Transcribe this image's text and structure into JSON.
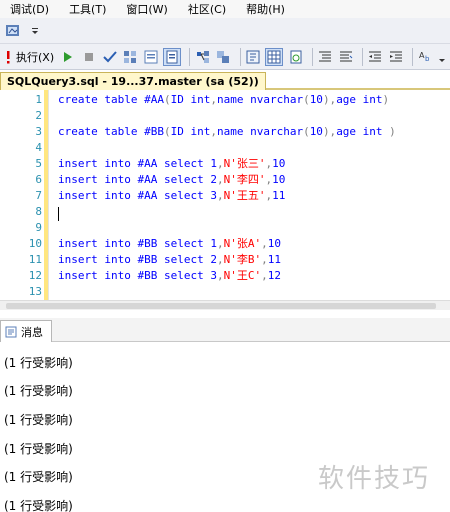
{
  "menubar": {
    "items": [
      "调试(D)",
      "工具(T)",
      "窗口(W)",
      "社区(C)",
      "帮助(H)"
    ]
  },
  "toolbar": {
    "execute_label": "执行(X)"
  },
  "tab": {
    "title": "SQLQuery3.sql - 19...37.master (sa (52))"
  },
  "editor": {
    "lines": [
      {
        "n": "1",
        "tokens": [
          {
            "t": "create table #AA",
            "c": ""
          },
          {
            "t": "(",
            "c": "gray"
          },
          {
            "t": "ID int",
            "c": ""
          },
          {
            "t": ",",
            "c": "gray"
          },
          {
            "t": "name nvarchar",
            "c": ""
          },
          {
            "t": "(",
            "c": "gray"
          },
          {
            "t": "10",
            "c": ""
          },
          {
            "t": "),",
            "c": "gray"
          },
          {
            "t": "age int",
            "c": ""
          },
          {
            "t": ")",
            "c": "gray"
          }
        ]
      },
      {
        "n": "2",
        "tokens": []
      },
      {
        "n": "3",
        "tokens": [
          {
            "t": "create table #BB",
            "c": ""
          },
          {
            "t": "(",
            "c": "gray"
          },
          {
            "t": "ID int",
            "c": ""
          },
          {
            "t": ",",
            "c": "gray"
          },
          {
            "t": "name nvarchar",
            "c": ""
          },
          {
            "t": "(",
            "c": "gray"
          },
          {
            "t": "10",
            "c": ""
          },
          {
            "t": "),",
            "c": "gray"
          },
          {
            "t": "age int ",
            "c": ""
          },
          {
            "t": ")",
            "c": "gray"
          }
        ]
      },
      {
        "n": "4",
        "tokens": []
      },
      {
        "n": "5",
        "tokens": [
          {
            "t": "insert into #AA select 1",
            "c": ""
          },
          {
            "t": ",",
            "c": "gray"
          },
          {
            "t": "N'张三'",
            "c": "red"
          },
          {
            "t": ",",
            "c": "gray"
          },
          {
            "t": "10",
            "c": ""
          }
        ]
      },
      {
        "n": "6",
        "tokens": [
          {
            "t": "insert into #AA select 2",
            "c": ""
          },
          {
            "t": ",",
            "c": "gray"
          },
          {
            "t": "N'李四'",
            "c": "red"
          },
          {
            "t": ",",
            "c": "gray"
          },
          {
            "t": "10",
            "c": ""
          }
        ]
      },
      {
        "n": "7",
        "tokens": [
          {
            "t": "insert into #AA select 3",
            "c": ""
          },
          {
            "t": ",",
            "c": "gray"
          },
          {
            "t": "N'王五'",
            "c": "red"
          },
          {
            "t": ",",
            "c": "gray"
          },
          {
            "t": "11",
            "c": ""
          }
        ]
      },
      {
        "n": "8",
        "tokens": []
      },
      {
        "n": "9",
        "tokens": []
      },
      {
        "n": "10",
        "tokens": [
          {
            "t": "insert into #BB select 1",
            "c": ""
          },
          {
            "t": ",",
            "c": "gray"
          },
          {
            "t": "N'张A'",
            "c": "red"
          },
          {
            "t": ",",
            "c": "gray"
          },
          {
            "t": "10",
            "c": ""
          }
        ]
      },
      {
        "n": "11",
        "tokens": [
          {
            "t": "insert into #BB select 2",
            "c": ""
          },
          {
            "t": ",",
            "c": "gray"
          },
          {
            "t": "N'李B'",
            "c": "red"
          },
          {
            "t": ",",
            "c": "gray"
          },
          {
            "t": "11",
            "c": ""
          }
        ]
      },
      {
        "n": "12",
        "tokens": [
          {
            "t": "insert into #BB select 3",
            "c": ""
          },
          {
            "t": ",",
            "c": "gray"
          },
          {
            "t": "N'王C'",
            "c": "red"
          },
          {
            "t": ",",
            "c": "gray"
          },
          {
            "t": "12",
            "c": ""
          }
        ]
      },
      {
        "n": "13",
        "tokens": []
      }
    ]
  },
  "results": {
    "tab_label": "消息",
    "messages": [
      "(1 行受影响)",
      "(1 行受影响)",
      "(1 行受影响)",
      "(1 行受影响)",
      "(1 行受影响)",
      "(1 行受影响)"
    ]
  },
  "watermark": "软件技巧",
  "icons": {
    "toolbar1": [
      "database-icon",
      "dropdown-arrow-icon"
    ],
    "toolbar2": [
      "exclamation-icon",
      "play-icon",
      "stop-icon",
      "checkmark-icon",
      "parse-icon",
      "results-to-icon",
      "results-grid-icon",
      "plan-icon",
      "query-options-icon",
      "results-text-icon",
      "results-grid-icon",
      "results-file-icon",
      "comment-icon",
      "uncomment-icon",
      "outdent-icon",
      "indent-icon",
      "spell-icon"
    ]
  },
  "colors": {
    "keyword": "#0000ff",
    "string": "#ff0000",
    "punct": "#808080",
    "line_number": "#2b91af"
  }
}
